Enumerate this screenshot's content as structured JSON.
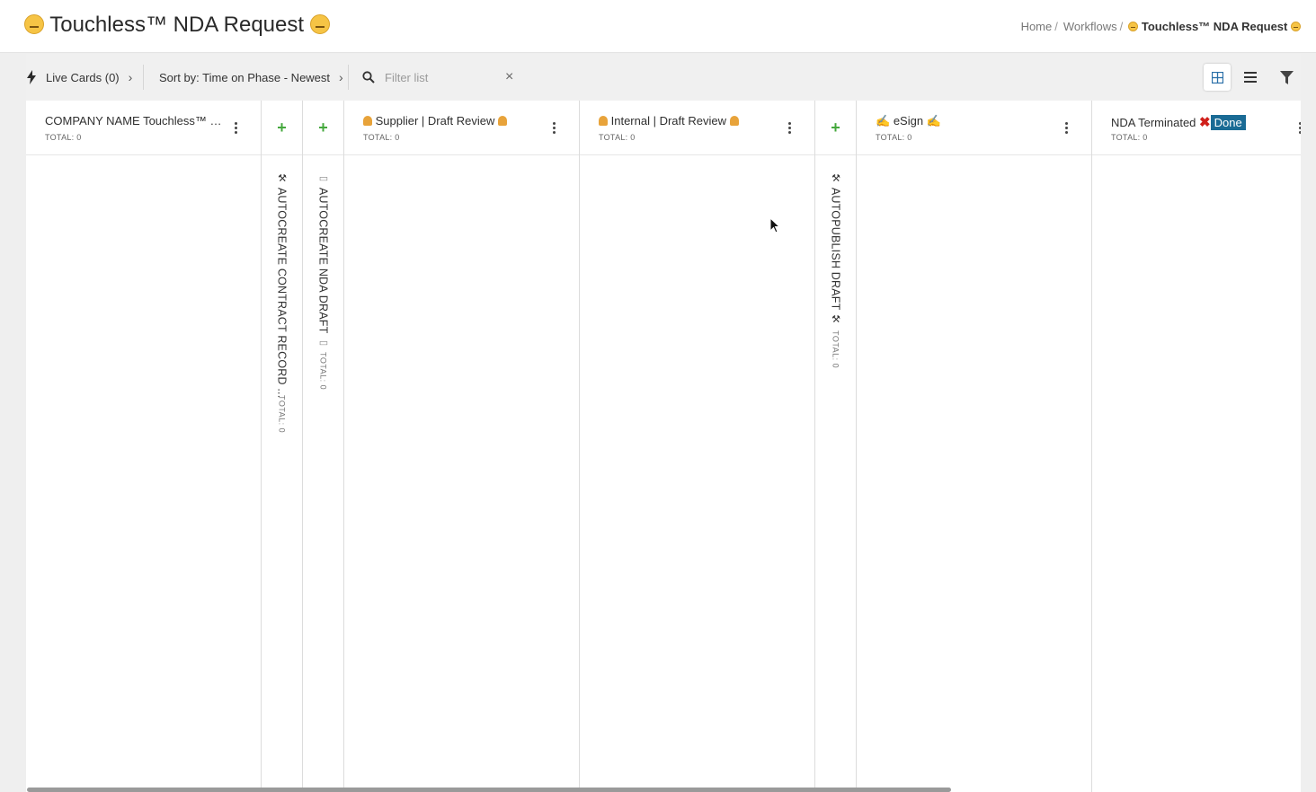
{
  "header": {
    "title": "Touchless™ NDA Request",
    "breadcrumb": {
      "home": "Home",
      "sep1": "/",
      "workflows": "Workflows",
      "sep2": "/",
      "current": "Touchless™ NDA Request"
    }
  },
  "toolbar": {
    "live_cards": "Live Cards (0)",
    "sort": "Sort by: Time on Phase - Newest",
    "filter_placeholder": "Filter list",
    "clear_symbol": "×"
  },
  "columns": [
    {
      "title": "COMPANY NAME Touchless™ N...",
      "total": "TOTAL: 0"
    },
    {
      "title": "AUTOCREATE CONTRACT RECORD ...",
      "total": "TOTAL: 0",
      "add_symbol": "+"
    },
    {
      "title": "AUTOCREATE NDA DRAFT",
      "total": "TOTAL: 0",
      "add_symbol": "+"
    },
    {
      "title": "Supplier | Draft Review",
      "total": "TOTAL: 0"
    },
    {
      "title": "Internal | Draft Review",
      "total": "TOTAL: 0"
    },
    {
      "title": "AUTOPUBLISH DRAFT",
      "total": "TOTAL: 0",
      "add_symbol": "+"
    },
    {
      "title": "eSign",
      "total": "TOTAL: 0",
      "icon": "✍"
    },
    {
      "title": "NDA Terminated",
      "total": "TOTAL: 0",
      "x_symbol": "✖",
      "badge": "Done"
    }
  ],
  "icons": {
    "live": "lightning-icon",
    "search": "search-icon",
    "grid_view": "grid-view-icon",
    "list_view": "list-view-icon",
    "filter": "filter-icon"
  },
  "colors": {
    "accent": "#1a6b95",
    "add_green": "#45a83d",
    "terminated_red": "#d0201b"
  }
}
